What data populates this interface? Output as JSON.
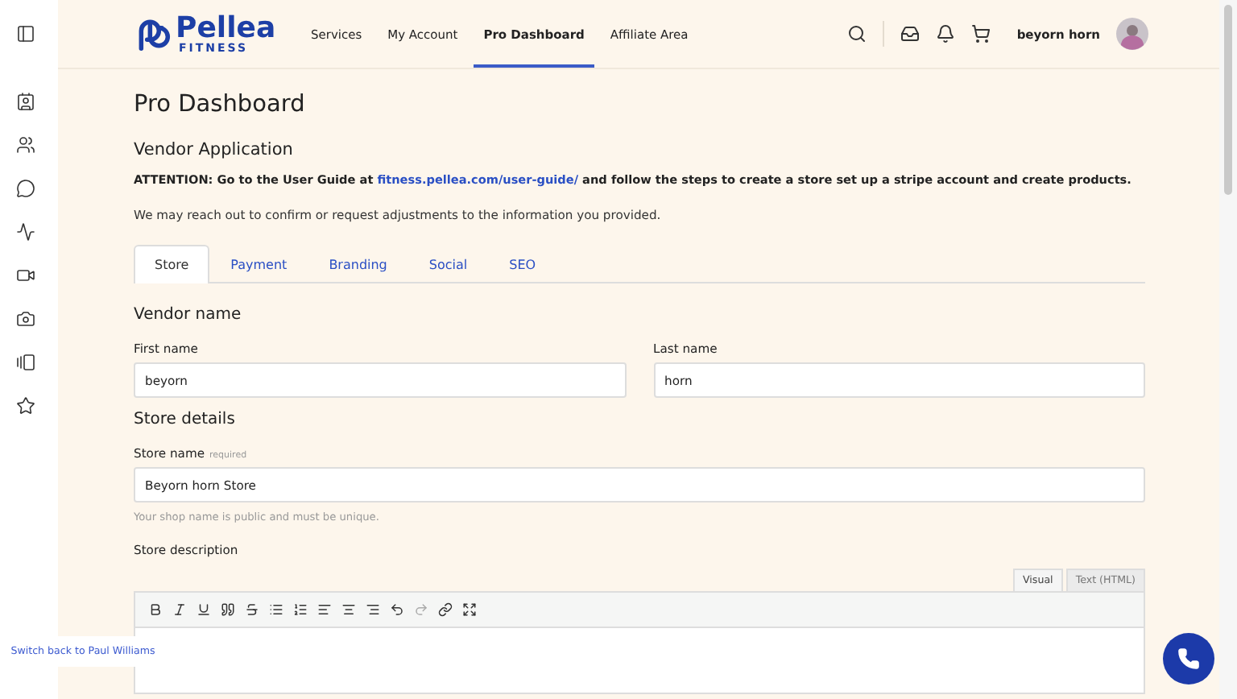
{
  "logo": {
    "name": "Pellea",
    "tagline": "FITNESS"
  },
  "nav": [
    {
      "label": "Services",
      "selected": false
    },
    {
      "label": "My Account",
      "selected": false
    },
    {
      "label": "Pro Dashboard",
      "selected": true
    },
    {
      "label": "Affiliate Area",
      "selected": false
    }
  ],
  "user": {
    "name": "beyorn horn"
  },
  "page_title": "Pro Dashboard",
  "section_title": "Vendor Application",
  "attention": {
    "before": "ATTENTION: Go to the User Guide at ",
    "link": "fitness.pellea.com/user-guide/",
    "after": " and follow the steps to create a store set up a stripe account and create products."
  },
  "note": "We may reach out to confirm or request adjustments to the information you provided.",
  "tabs": [
    {
      "label": "Store",
      "selected": true
    },
    {
      "label": "Payment",
      "selected": false
    },
    {
      "label": "Branding",
      "selected": false
    },
    {
      "label": "Social",
      "selected": false
    },
    {
      "label": "SEO",
      "selected": false
    }
  ],
  "vendor_name": {
    "heading": "Vendor name",
    "first_label": "First name",
    "first_value": "beyorn",
    "last_label": "Last name",
    "last_value": "horn"
  },
  "store_details": {
    "heading": "Store details",
    "store_name_label": "Store name",
    "required": "required",
    "store_name_value": "Beyorn horn Store",
    "hint": "Your shop name is public and must be unique.",
    "description_label": "Store description"
  },
  "editor_tabs": [
    {
      "label": "Visual",
      "selected": true
    },
    {
      "label": "Text (HTML)",
      "selected": false
    }
  ],
  "switch_back": "Switch back to Paul Williams"
}
